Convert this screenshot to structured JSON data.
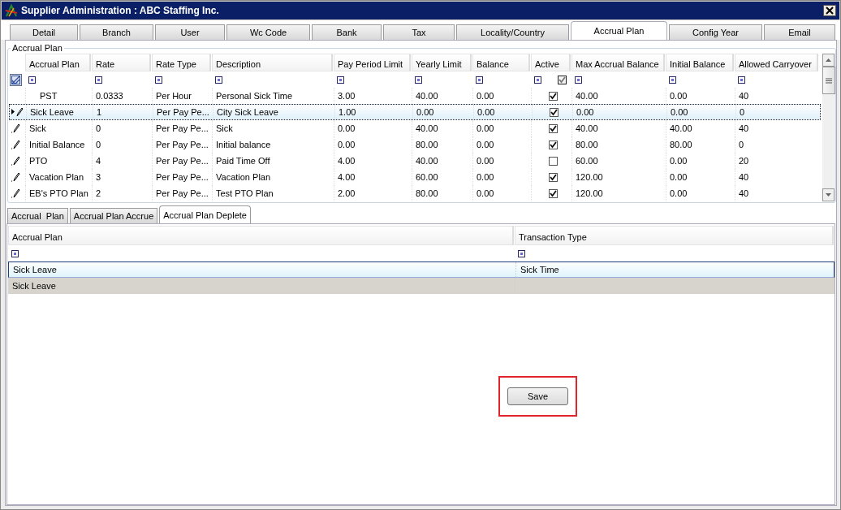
{
  "window": {
    "title": "Supplier Administration : ABC Staffing Inc."
  },
  "tabs": [
    {
      "label": "Detail",
      "selected": false
    },
    {
      "label": "Branch",
      "selected": false
    },
    {
      "label": "User",
      "selected": false
    },
    {
      "label": "Wc Code",
      "selected": false
    },
    {
      "label": "Bank",
      "selected": false
    },
    {
      "label": "Tax",
      "selected": false
    },
    {
      "label": "Locality/Country",
      "selected": false
    },
    {
      "label": "Accrual Plan",
      "selected": true
    },
    {
      "label": "Config Year",
      "selected": false
    },
    {
      "label": "Email",
      "selected": false
    }
  ],
  "group": {
    "title": "Accrual Plan"
  },
  "plan_grid": {
    "columns": [
      {
        "label": "Accrual Plan",
        "kind": "text"
      },
      {
        "label": "Rate",
        "kind": "text"
      },
      {
        "label": "Rate Type",
        "kind": "text"
      },
      {
        "label": "Description",
        "kind": "text"
      },
      {
        "label": "Pay Period Limit",
        "kind": "text"
      },
      {
        "label": "Yearly Limit",
        "kind": "text"
      },
      {
        "label": "Balance",
        "kind": "text"
      },
      {
        "label": "Active",
        "kind": "check",
        "filter_checked": true
      },
      {
        "label": "Max Accrual Balance",
        "kind": "text"
      },
      {
        "label": "Initial Balance",
        "kind": "text"
      },
      {
        "label": "Allowed Carryover",
        "kind": "text"
      }
    ],
    "rows": [
      {
        "kind": "none",
        "selected": false,
        "cells": [
          "PST",
          "0.0333",
          "Per Hour",
          "Personal Sick Time",
          "3.00",
          "40.00",
          "0.00",
          true,
          "40.00",
          "0.00",
          "40"
        ]
      },
      {
        "kind": "current",
        "selected": true,
        "cells": [
          "Sick Leave",
          "1",
          "Per Pay Pe...",
          "City Sick Leave",
          "1.00",
          "0.00",
          "0.00",
          true,
          "0.00",
          "0.00",
          "0"
        ]
      },
      {
        "kind": "edit",
        "selected": false,
        "cells": [
          "Sick",
          "0",
          "Per Pay Pe...",
          "Sick",
          "0.00",
          "40.00",
          "0.00",
          true,
          "40.00",
          "40.00",
          "40"
        ]
      },
      {
        "kind": "edit",
        "selected": false,
        "cells": [
          "Initial Balance",
          "0",
          "Per Pay Pe...",
          "Initial balance",
          "0.00",
          "80.00",
          "0.00",
          true,
          "80.00",
          "80.00",
          "0"
        ]
      },
      {
        "kind": "edit",
        "selected": false,
        "cells": [
          "PTO",
          "4",
          "Per Pay Pe...",
          "Paid Time Off",
          "4.00",
          "40.00",
          "0.00",
          false,
          "60.00",
          "0.00",
          "20"
        ]
      },
      {
        "kind": "edit",
        "selected": false,
        "cells": [
          "Vacation Plan",
          "3",
          "Per Pay Pe...",
          "Vacation Plan",
          "4.00",
          "60.00",
          "0.00",
          true,
          "120.00",
          "0.00",
          "40"
        ]
      },
      {
        "kind": "edit",
        "selected": false,
        "cells": [
          "EB's PTO Plan",
          "2",
          "Per Pay Pe...",
          "Test PTO Plan",
          "2.00",
          "80.00",
          "0.00",
          true,
          "120.00",
          "0.00",
          "40"
        ]
      }
    ]
  },
  "sub_tabs": [
    {
      "label": "Accrual  Plan",
      "selected": false
    },
    {
      "label": "Accrual Plan Accrue",
      "selected": false
    },
    {
      "label": "Accrual Plan Deplete",
      "selected": true
    }
  ],
  "deplete_grid": {
    "columns": [
      "Accrual Plan",
      "Transaction Type"
    ],
    "rows": [
      {
        "kind": "data",
        "selected": true,
        "cells": [
          "Sick Leave",
          "Sick Time"
        ]
      },
      {
        "kind": "new",
        "selected": false,
        "cells": [
          "Sick Leave",
          ""
        ]
      }
    ]
  },
  "save_button": {
    "label": "Save",
    "highlighted": true
  }
}
